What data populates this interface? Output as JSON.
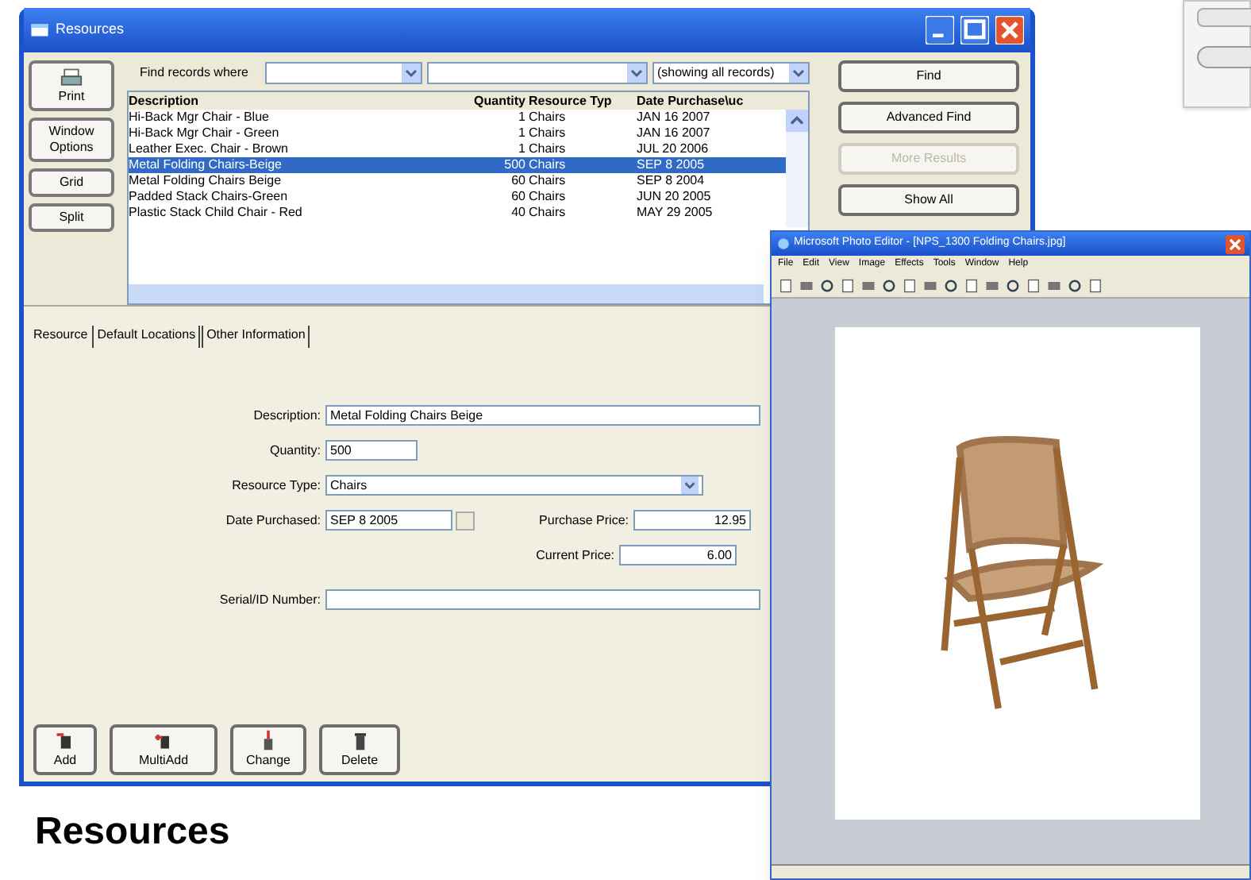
{
  "main_window": {
    "title": "Resources",
    "left_buttons": [
      {
        "label": "Print"
      },
      {
        "label": "Window Options"
      },
      {
        "label": "Grid"
      },
      {
        "label": "Split"
      }
    ],
    "find": {
      "label": "Find records where",
      "field_3": "(showing all records)"
    },
    "action_buttons": [
      {
        "label": "Find",
        "disabled": false
      },
      {
        "label": "Advanced Find",
        "disabled": false
      },
      {
        "label": "More Results",
        "disabled": true
      },
      {
        "label": "Show All",
        "disabled": false
      }
    ],
    "table": {
      "columns": [
        "Description",
        "Quantity",
        "Resource Typ",
        "Date Purchase\\uc"
      ],
      "rows": [
        {
          "cells": [
            "Hi-Back Mgr Chair - Blue",
            "1",
            "Chairs",
            "JAN 16 2007"
          ],
          "selected": false
        },
        {
          "cells": [
            "Hi-Back Mgr Chair - Green",
            "1",
            "Chairs",
            "JAN 16 2007"
          ],
          "selected": false
        },
        {
          "cells": [
            "Leather Exec. Chair - Brown",
            "1",
            "Chairs",
            "JUL 20 2006"
          ],
          "selected": false
        },
        {
          "cells": [
            "Metal Folding Chairs-Beige",
            "500",
            "Chairs",
            "SEP 8 2005"
          ],
          "selected": true
        },
        {
          "cells": [
            "Metal Folding Chairs Beige",
            "60",
            "Chairs",
            "SEP 8 2004"
          ],
          "selected": false
        },
        {
          "cells": [
            "Padded Stack Chairs-Green",
            "60",
            "Chairs",
            "JUN 20 2005"
          ],
          "selected": false
        },
        {
          "cells": [
            "Plastic Stack Child Chair - Red",
            "40",
            "Chairs",
            "MAY 29 2005"
          ],
          "selected": false
        }
      ]
    },
    "tabs": [
      {
        "label": "Resource",
        "selected": true
      },
      {
        "label": "Default Locations",
        "selected": false
      },
      {
        "label": "Other Information",
        "selected": false
      }
    ],
    "form": [
      {
        "label": "Description:",
        "value": "Metal Folding Chairs Beige",
        "kind": "wide"
      },
      {
        "label": "Quantity:",
        "value": "500",
        "kind": "short"
      },
      {
        "label": "Resource Type:",
        "value": "Chairs",
        "kind": "dropdown"
      },
      {
        "label": "Date Purchased:",
        "value": "SEP 8 2005",
        "kind": "date"
      },
      {
        "label": "Purchase Price:",
        "value": "12.95",
        "kind": "price"
      },
      {
        "label": "Current Price:",
        "value": "6.00",
        "kind": "price"
      },
      {
        "label": "Serial/ID Number:",
        "kind": "wide"
      }
    ],
    "bottom_buttons": [
      {
        "label": "Add"
      },
      {
        "label": "MultiAdd"
      },
      {
        "label": "Change"
      },
      {
        "label": "Delete"
      }
    ]
  },
  "caption": "Resources",
  "photo_editor": {
    "title": "Microsoft Photo Editor - [NPS_1300 Folding Chairs.jpg]",
    "menu": [
      "File",
      "Edit",
      "View",
      "Image",
      "Effects",
      "Tools",
      "Window",
      "Help"
    ]
  }
}
